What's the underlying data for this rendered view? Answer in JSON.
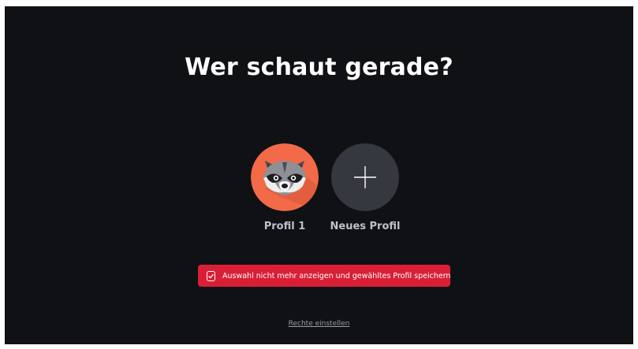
{
  "page": {
    "title": "Wer schaut gerade?"
  },
  "profiles": [
    {
      "label": "Profil 1",
      "avatar_icon": "raccoon-icon",
      "avatar_color": "#f26a47"
    },
    {
      "label": "Neues Profil",
      "avatar_icon": "plus-icon",
      "avatar_color": "#35383f"
    }
  ],
  "remember_choice": {
    "label": "Auswahl nicht mehr anzeigen und gewähltes Profil speichern",
    "checked": true,
    "color": "#d91f35"
  },
  "rights_link": {
    "label": "Rechte einstellen"
  }
}
